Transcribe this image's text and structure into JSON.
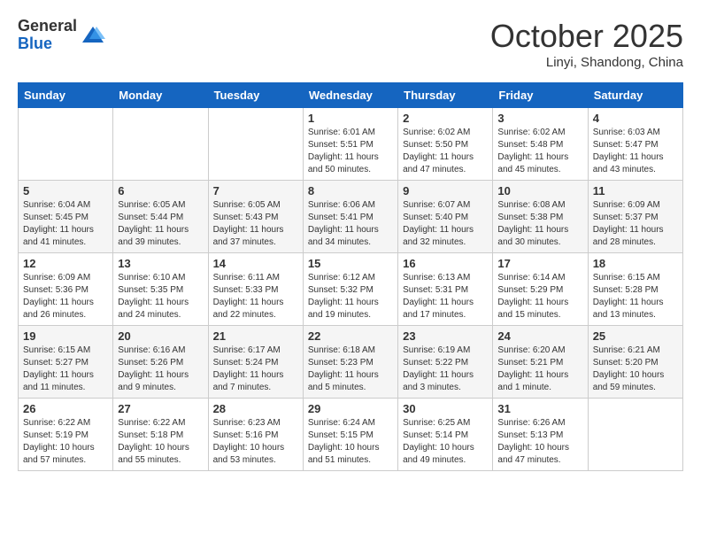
{
  "logo": {
    "general": "General",
    "blue": "Blue"
  },
  "title": "October 2025",
  "location": "Linyi, Shandong, China",
  "days_of_week": [
    "Sunday",
    "Monday",
    "Tuesday",
    "Wednesday",
    "Thursday",
    "Friday",
    "Saturday"
  ],
  "weeks": [
    [
      {
        "day": "",
        "info": ""
      },
      {
        "day": "",
        "info": ""
      },
      {
        "day": "",
        "info": ""
      },
      {
        "day": "1",
        "info": "Sunrise: 6:01 AM\nSunset: 5:51 PM\nDaylight: 11 hours\nand 50 minutes."
      },
      {
        "day": "2",
        "info": "Sunrise: 6:02 AM\nSunset: 5:50 PM\nDaylight: 11 hours\nand 47 minutes."
      },
      {
        "day": "3",
        "info": "Sunrise: 6:02 AM\nSunset: 5:48 PM\nDaylight: 11 hours\nand 45 minutes."
      },
      {
        "day": "4",
        "info": "Sunrise: 6:03 AM\nSunset: 5:47 PM\nDaylight: 11 hours\nand 43 minutes."
      }
    ],
    [
      {
        "day": "5",
        "info": "Sunrise: 6:04 AM\nSunset: 5:45 PM\nDaylight: 11 hours\nand 41 minutes."
      },
      {
        "day": "6",
        "info": "Sunrise: 6:05 AM\nSunset: 5:44 PM\nDaylight: 11 hours\nand 39 minutes."
      },
      {
        "day": "7",
        "info": "Sunrise: 6:05 AM\nSunset: 5:43 PM\nDaylight: 11 hours\nand 37 minutes."
      },
      {
        "day": "8",
        "info": "Sunrise: 6:06 AM\nSunset: 5:41 PM\nDaylight: 11 hours\nand 34 minutes."
      },
      {
        "day": "9",
        "info": "Sunrise: 6:07 AM\nSunset: 5:40 PM\nDaylight: 11 hours\nand 32 minutes."
      },
      {
        "day": "10",
        "info": "Sunrise: 6:08 AM\nSunset: 5:38 PM\nDaylight: 11 hours\nand 30 minutes."
      },
      {
        "day": "11",
        "info": "Sunrise: 6:09 AM\nSunset: 5:37 PM\nDaylight: 11 hours\nand 28 minutes."
      }
    ],
    [
      {
        "day": "12",
        "info": "Sunrise: 6:09 AM\nSunset: 5:36 PM\nDaylight: 11 hours\nand 26 minutes."
      },
      {
        "day": "13",
        "info": "Sunrise: 6:10 AM\nSunset: 5:35 PM\nDaylight: 11 hours\nand 24 minutes."
      },
      {
        "day": "14",
        "info": "Sunrise: 6:11 AM\nSunset: 5:33 PM\nDaylight: 11 hours\nand 22 minutes."
      },
      {
        "day": "15",
        "info": "Sunrise: 6:12 AM\nSunset: 5:32 PM\nDaylight: 11 hours\nand 19 minutes."
      },
      {
        "day": "16",
        "info": "Sunrise: 6:13 AM\nSunset: 5:31 PM\nDaylight: 11 hours\nand 17 minutes."
      },
      {
        "day": "17",
        "info": "Sunrise: 6:14 AM\nSunset: 5:29 PM\nDaylight: 11 hours\nand 15 minutes."
      },
      {
        "day": "18",
        "info": "Sunrise: 6:15 AM\nSunset: 5:28 PM\nDaylight: 11 hours\nand 13 minutes."
      }
    ],
    [
      {
        "day": "19",
        "info": "Sunrise: 6:15 AM\nSunset: 5:27 PM\nDaylight: 11 hours\nand 11 minutes."
      },
      {
        "day": "20",
        "info": "Sunrise: 6:16 AM\nSunset: 5:26 PM\nDaylight: 11 hours\nand 9 minutes."
      },
      {
        "day": "21",
        "info": "Sunrise: 6:17 AM\nSunset: 5:24 PM\nDaylight: 11 hours\nand 7 minutes."
      },
      {
        "day": "22",
        "info": "Sunrise: 6:18 AM\nSunset: 5:23 PM\nDaylight: 11 hours\nand 5 minutes."
      },
      {
        "day": "23",
        "info": "Sunrise: 6:19 AM\nSunset: 5:22 PM\nDaylight: 11 hours\nand 3 minutes."
      },
      {
        "day": "24",
        "info": "Sunrise: 6:20 AM\nSunset: 5:21 PM\nDaylight: 11 hours\nand 1 minute."
      },
      {
        "day": "25",
        "info": "Sunrise: 6:21 AM\nSunset: 5:20 PM\nDaylight: 10 hours\nand 59 minutes."
      }
    ],
    [
      {
        "day": "26",
        "info": "Sunrise: 6:22 AM\nSunset: 5:19 PM\nDaylight: 10 hours\nand 57 minutes."
      },
      {
        "day": "27",
        "info": "Sunrise: 6:22 AM\nSunset: 5:18 PM\nDaylight: 10 hours\nand 55 minutes."
      },
      {
        "day": "28",
        "info": "Sunrise: 6:23 AM\nSunset: 5:16 PM\nDaylight: 10 hours\nand 53 minutes."
      },
      {
        "day": "29",
        "info": "Sunrise: 6:24 AM\nSunset: 5:15 PM\nDaylight: 10 hours\nand 51 minutes."
      },
      {
        "day": "30",
        "info": "Sunrise: 6:25 AM\nSunset: 5:14 PM\nDaylight: 10 hours\nand 49 minutes."
      },
      {
        "day": "31",
        "info": "Sunrise: 6:26 AM\nSunset: 5:13 PM\nDaylight: 10 hours\nand 47 minutes."
      },
      {
        "day": "",
        "info": ""
      }
    ]
  ]
}
